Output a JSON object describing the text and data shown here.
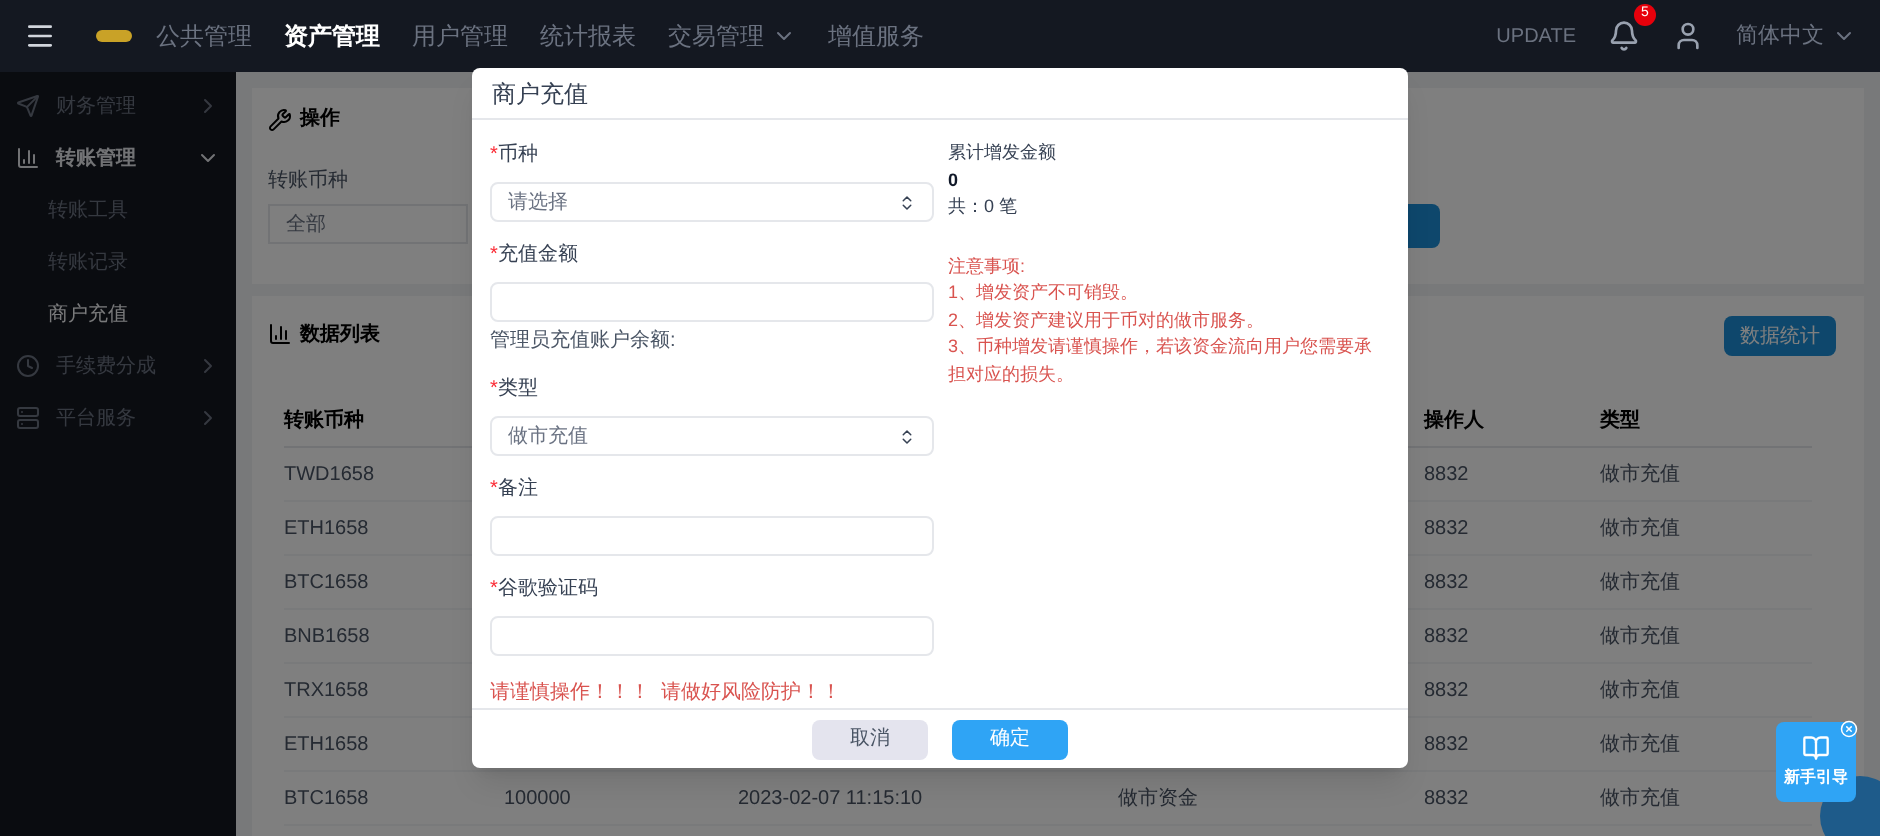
{
  "top_nav": {
    "items": [
      {
        "label": "公共管理",
        "selected": false,
        "has_caret": false
      },
      {
        "label": "资产管理",
        "selected": true,
        "has_caret": false
      },
      {
        "label": "用户管理",
        "selected": false,
        "has_caret": false
      },
      {
        "label": "统计报表",
        "selected": false,
        "has_caret": false
      },
      {
        "label": "交易管理",
        "selected": false,
        "has_caret": true
      },
      {
        "label": "增值服务",
        "selected": false,
        "has_caret": false
      }
    ],
    "update_label": "UPDATE",
    "notification_count": "5",
    "language": "简体中文"
  },
  "sidebar": {
    "items": [
      {
        "label": "财务管理",
        "expanded": false
      },
      {
        "label": "转账管理",
        "expanded": true,
        "children": [
          {
            "label": "转账工具",
            "selected": false
          },
          {
            "label": "转账记录",
            "selected": false
          },
          {
            "label": "商户充值",
            "selected": true
          }
        ]
      },
      {
        "label": "手续费分成",
        "expanded": false
      },
      {
        "label": "平台服务",
        "expanded": false
      }
    ]
  },
  "operation_panel": {
    "title": "操作",
    "currency_label": "转账币种",
    "currency_value": "全部"
  },
  "data_panel": {
    "title": "数据列表",
    "stats_button": "数据统计",
    "columns": [
      "转账币种",
      "操作人",
      "类型"
    ],
    "rows": [
      {
        "currency": "TWD1658",
        "operator": "8832",
        "type": "做市充值"
      },
      {
        "currency": "ETH1658",
        "operator": "8832",
        "type": "做市充值"
      },
      {
        "currency": "BTC1658",
        "operator": "8832",
        "type": "做市充值"
      },
      {
        "currency": "BNB1658",
        "operator": "8832",
        "type": "做市充值"
      },
      {
        "currency": "TRX1658",
        "operator": "8832",
        "type": "做市充值"
      },
      {
        "currency": "ETH1658",
        "operator": "8832",
        "type": "做市充值"
      },
      {
        "currency": "BTC1658",
        "column_2": "100000",
        "column_3": "2023-02-07 11:15:10",
        "column_4": "做市资金",
        "operator": "8832",
        "type": "做市充值"
      }
    ]
  },
  "dialog": {
    "title": "商户充值",
    "fields": [
      {
        "kind": "select",
        "label": "币种",
        "required_mark": "*",
        "value": "请选择"
      },
      {
        "kind": "input",
        "label": "充值金额",
        "required_mark": "*",
        "hint": "管理员充值账户余额:"
      },
      {
        "kind": "select",
        "label": "类型",
        "required_mark": "*",
        "value": "做市充值"
      },
      {
        "kind": "input",
        "label": "备注",
        "required_mark": "*"
      },
      {
        "kind": "input",
        "label": "谷歌验证码",
        "required_mark": "*"
      }
    ],
    "warning": "请谨慎操作！！！  请做好风险防护！！",
    "summary": {
      "label": "累计增发金额",
      "amount": "0",
      "count": "共：0 笔"
    },
    "notice": {
      "title": "注意事项:",
      "lines": [
        "1、增发资产不可销毁。",
        "2、增发资产建议用于币对的做市服务。",
        "3、币种增发请谨慎操作，若该资金流向用户您需要承担对应的损失。"
      ]
    },
    "cancel_button": "取消",
    "confirm_button": "确定"
  },
  "guide_widget": {
    "label": "新手引导"
  }
}
